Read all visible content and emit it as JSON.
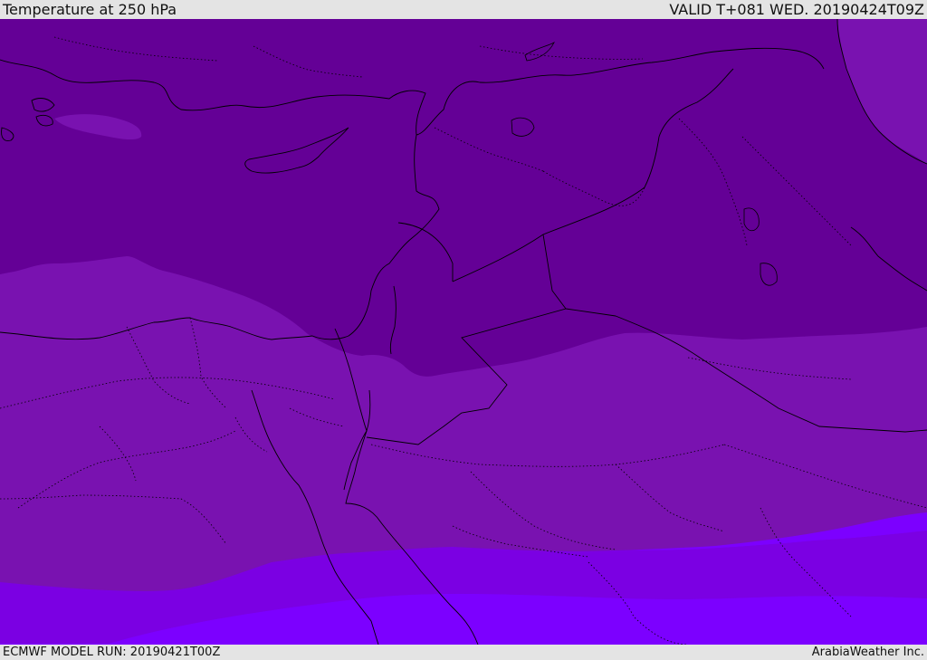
{
  "header": {
    "title": "Temperature at 250 hPa",
    "valid": "VALID T+081 WED. 20190424T09Z"
  },
  "footer": {
    "model_run": "ECMWF MODEL RUN: 20190421T00Z",
    "credit": "ArabiaWeather Inc."
  },
  "map": {
    "colors": {
      "band_cold": "#640096",
      "band_mid": "#7912b0",
      "band_warm": "#7b00e3",
      "band_warmest": "#7c00ff",
      "line": "#000000",
      "background_bar": "#e4e4e4"
    },
    "layers": [
      "temperature-bands",
      "coastlines",
      "country-borders",
      "region-borders"
    ]
  }
}
